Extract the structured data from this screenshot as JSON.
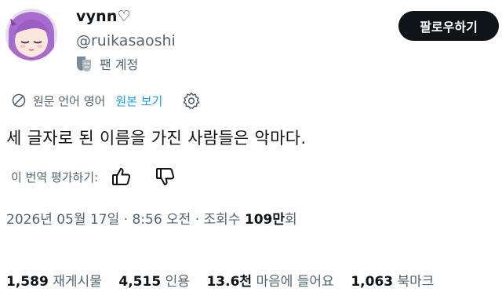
{
  "profile": {
    "display_name": "vynn♡",
    "handle": "@ruikasaoshi",
    "badge_icon": "theater-mask-icon",
    "badge_label": "팬 계정",
    "follow_label": "팔로우하기"
  },
  "translation": {
    "icon": "globe-icon",
    "source_language": "원문 언어 영어",
    "view_original_label": "원본 보기",
    "settings_icon": "gear-icon"
  },
  "tweet": {
    "text": "세 글자로 된 이름을 가진 사람들은 악마다."
  },
  "rating": {
    "label": "이 번역 평가하기:",
    "thumbs_up_icon": "thumbs-up-icon",
    "thumbs_down_icon": "thumbs-down-icon"
  },
  "meta": {
    "date_time": "2026년 05월 17일 · 8:56 오전 · 조회수 ",
    "views_number": "109만",
    "views_suffix": "회"
  },
  "stats": {
    "retweets_count": "1,589",
    "retweets_label": "재게시물",
    "quotes_count": "4,515",
    "quotes_label": "인용",
    "likes_count": "13.6천",
    "likes_label": "마음에 들어요",
    "bookmarks_count": "1,063",
    "bookmarks_label": "북마크"
  },
  "colors": {
    "text": "#0f1419",
    "secondary": "#536471",
    "link": "#1d9bf0",
    "button_bg": "#0f1419",
    "avatar_hair": "#b57ad6"
  }
}
